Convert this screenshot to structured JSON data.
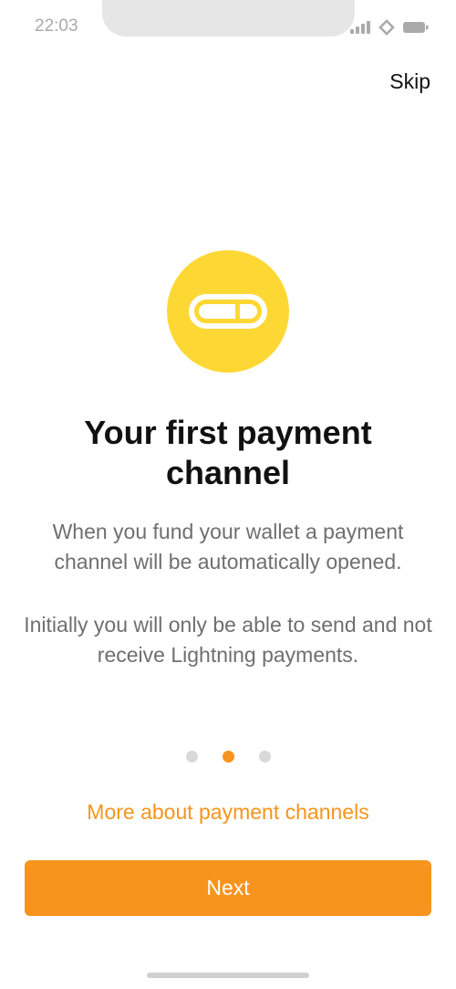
{
  "status_bar": {
    "time": "22:03",
    "icons": [
      "signal-icon",
      "wifi-icon",
      "battery-icon"
    ]
  },
  "skip_label": "Skip",
  "illustration": {
    "icon": "payment-channel-icon",
    "circle_color": "#fdd835"
  },
  "title": "Your first payment channel",
  "description": {
    "paragraph_1": "When you fund your wallet a payment channel will be automatically opened.",
    "paragraph_2": "Initially you will only be able to send and not receive Lightning payments."
  },
  "pagination": {
    "total": 3,
    "active_index": 1
  },
  "more_link": "More about payment channels",
  "next_label": "Next",
  "colors": {
    "accent": "#f7941d",
    "text_primary": "#111111",
    "text_secondary": "#6f6f6f"
  }
}
